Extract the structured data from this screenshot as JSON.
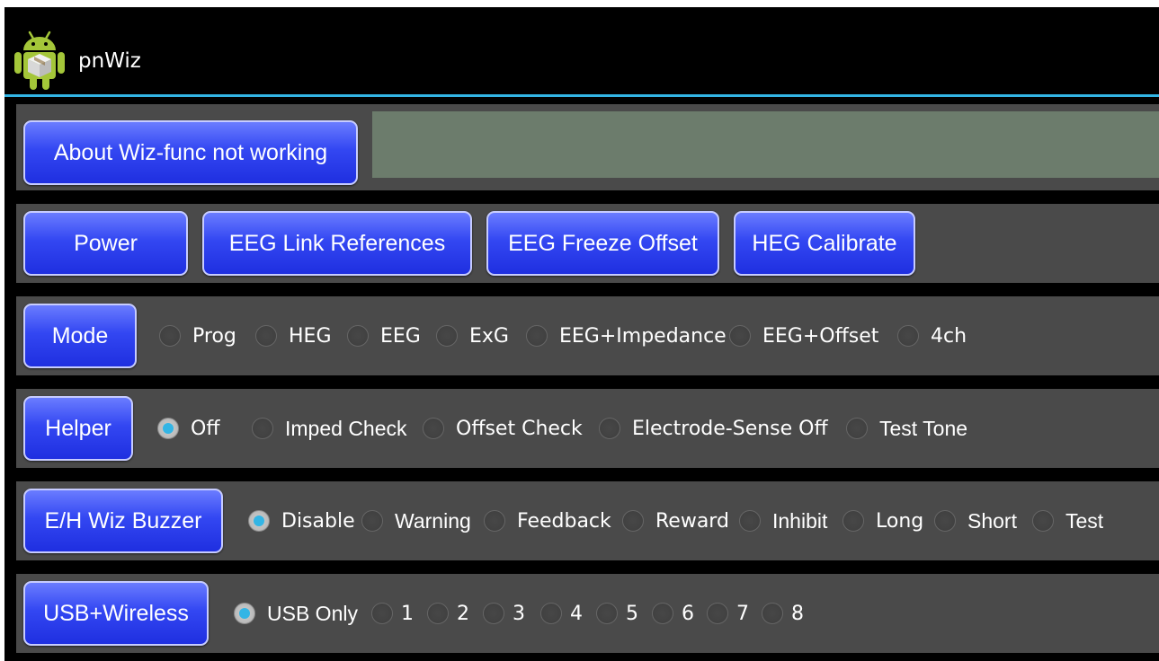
{
  "app": {
    "title": "pnWiz",
    "icon": "android-robot-icon"
  },
  "status": {
    "about_button": "About Wiz-func not working"
  },
  "commands": {
    "power": "Power",
    "eeg_link_references": "EEG Link References",
    "eeg_freeze_offset": "EEG Freeze Offset",
    "heg_calibrate": "HEG Calibrate"
  },
  "mode": {
    "button": "Mode",
    "options": [
      "Prog",
      "HEG",
      "EEG",
      "ExG",
      "EEG+Impedance",
      "EEG+Offset",
      "4ch"
    ],
    "selected": null
  },
  "helper": {
    "button": "Helper",
    "options": [
      "Off",
      "Imped Check",
      "Offset Check",
      "Electrode-Sense Off",
      "Test Tone"
    ],
    "selected": "Off"
  },
  "buzzer": {
    "button": "E/H Wiz Buzzer",
    "options": [
      "Disable",
      "Warning",
      "Feedback",
      "Reward",
      "Inhibit",
      "Long",
      "Short",
      "Test"
    ],
    "selected": "Disable"
  },
  "usb_wireless": {
    "button": "USB+Wireless",
    "options": [
      "USB Only",
      "1",
      "2",
      "3",
      "4",
      "5",
      "6",
      "7",
      "8"
    ],
    "selected": "USB Only"
  },
  "colors": {
    "button_blue": "#3347f2",
    "row_gray": "#4a4a4a",
    "readout_green": "#6c7c6c",
    "accent": "#33b5e5"
  }
}
